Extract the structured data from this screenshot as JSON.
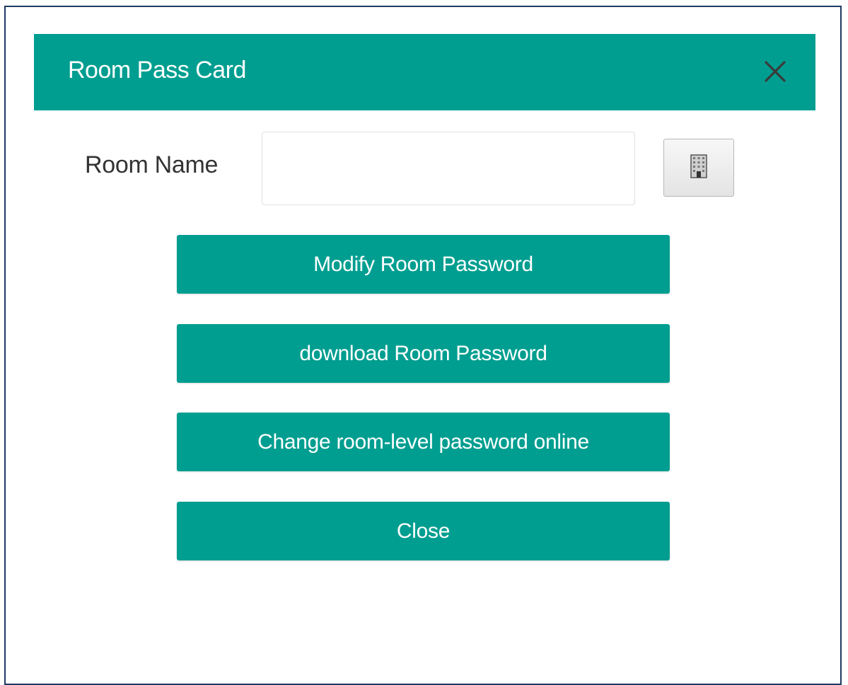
{
  "dialog": {
    "title": "Room Pass Card",
    "close_icon": "close-icon"
  },
  "form": {
    "room_name_label": "Room Name",
    "room_name_value": "",
    "room_picker_icon": "building-icon"
  },
  "actions": {
    "modify_label": "Modify Room Password",
    "download_label": "download Room Password",
    "change_online_label": "Change room-level password online",
    "close_label": "Close"
  },
  "colors": {
    "accent": "#009e90",
    "frame_border": "#1f3a64",
    "button_text": "#ffffff"
  }
}
